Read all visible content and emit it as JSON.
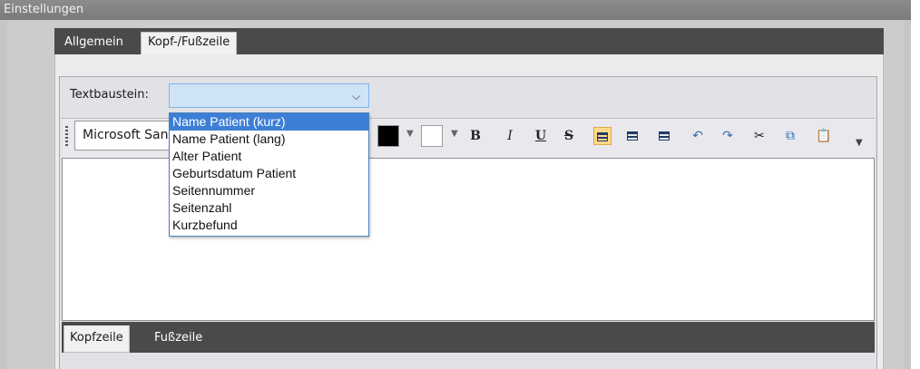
{
  "window": {
    "title": "Einstellungen"
  },
  "tabs": [
    {
      "label": "Allgemein",
      "active": false
    },
    {
      "label": "Kopf-/Fußzeile",
      "active": true
    }
  ],
  "textbaustein": {
    "label": "Textbaustein:",
    "value": "",
    "options": [
      "Name Patient (kurz)",
      "Name Patient (lang)",
      "Alter Patient",
      "Geburtsdatum Patient",
      "Seitennummer",
      "Seitenzahl",
      "Kurzbefund"
    ],
    "highlighted_index": 0
  },
  "toolbar": {
    "font_name": "Microsoft Sans Serif",
    "text_color": "#000000",
    "background_color": "#ffffff",
    "bold_label": "B",
    "italic_label": "I",
    "underline_label": "U",
    "strike_label": "S",
    "active_alignment": "left",
    "icons": [
      "bold-icon",
      "italic-icon",
      "underline-icon",
      "strikethrough-icon",
      "align-left-icon",
      "align-center-icon",
      "align-right-icon",
      "undo-icon",
      "redo-icon",
      "cut-icon",
      "copy-icon",
      "paste-icon"
    ]
  },
  "bottom_tabs": [
    {
      "label": "Kopfzeile",
      "active": true
    },
    {
      "label": "Fußzeile",
      "active": false
    }
  ],
  "colors": {
    "accent": "#3d7fd6",
    "tab_strip": "#4a4a4a",
    "combo_bg": "#cfe3f7"
  }
}
